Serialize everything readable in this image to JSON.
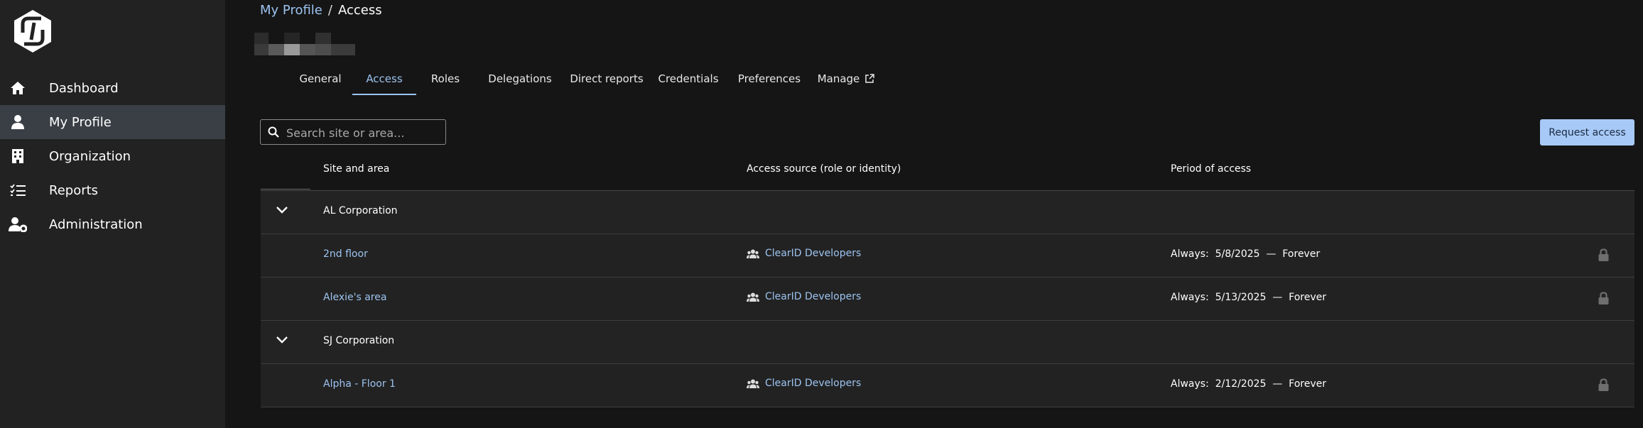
{
  "sidebar": {
    "items": [
      {
        "label": "Dashboard",
        "icon": "home-icon"
      },
      {
        "label": "My Profile",
        "icon": "user-icon",
        "active": true
      },
      {
        "label": "Organization",
        "icon": "building-icon"
      },
      {
        "label": "Reports",
        "icon": "checklist-icon"
      },
      {
        "label": "Administration",
        "icon": "user-gear-icon"
      }
    ]
  },
  "breadcrumb": {
    "parent": "My Profile",
    "separator": "/",
    "current": "Access"
  },
  "tabs": [
    "General",
    "Access",
    "Roles",
    "Delegations",
    "Direct reports",
    "Credentials",
    "Preferences",
    "Manage"
  ],
  "active_tab": "Access",
  "search": {
    "placeholder": "Search site or area...",
    "value": ""
  },
  "request_button": "Request access",
  "table": {
    "columns": [
      "Site and area",
      "Access source (role or identity)",
      "Period of access"
    ],
    "groups": [
      {
        "name": "AL Corporation",
        "rows": [
          {
            "site": "2nd floor",
            "source": "ClearID Developers",
            "period": "Always:  5/8/2025  —  Forever"
          },
          {
            "site": "Alexie's area",
            "source": "ClearID Developers",
            "period": "Always:  5/13/2025  —  Forever"
          }
        ]
      },
      {
        "name": "SJ Corporation",
        "rows": [
          {
            "site": "Alpha - Floor 1",
            "source": "ClearID Developers",
            "period": "Always:  2/12/2025  —  Forever"
          }
        ]
      }
    ]
  },
  "colors": {
    "accent": "#9cc3f0",
    "button": "#a7c9f7",
    "sidebar": "#222222",
    "sidebar_active": "#3a3f46",
    "background": "#151515"
  }
}
